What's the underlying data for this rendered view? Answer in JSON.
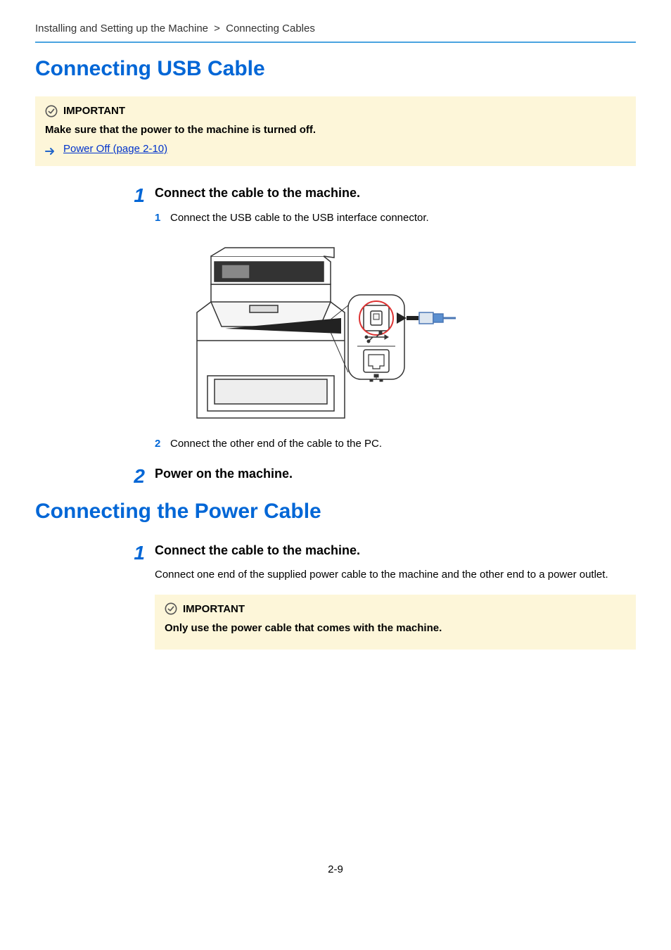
{
  "breadcrumb": {
    "parent": "Installing and Setting up the Machine",
    "sep": ">",
    "child": "Connecting Cables"
  },
  "section1": {
    "title": "Connecting USB Cable",
    "important": {
      "label": "IMPORTANT",
      "text": "Make sure that the power to the machine is turned off.",
      "link_text": "Power Off (page 2-10)"
    },
    "step1": {
      "num": "1",
      "title": "Connect the cable to the machine.",
      "sub1": {
        "num": "1",
        "text": "Connect the USB cable to the USB interface connector."
      },
      "sub2": {
        "num": "2",
        "text": "Connect the other end of the cable to the PC."
      }
    },
    "step2": {
      "num": "2",
      "title": "Power on the machine."
    }
  },
  "section2": {
    "title": "Connecting the Power Cable",
    "step1": {
      "num": "1",
      "title": "Connect the cable to the machine.",
      "para": "Connect one end of the supplied power cable to the machine and the other end to a power outlet.",
      "important": {
        "label": "IMPORTANT",
        "text": "Only use the power cable that comes with the machine."
      }
    }
  },
  "page_number": "2-9"
}
